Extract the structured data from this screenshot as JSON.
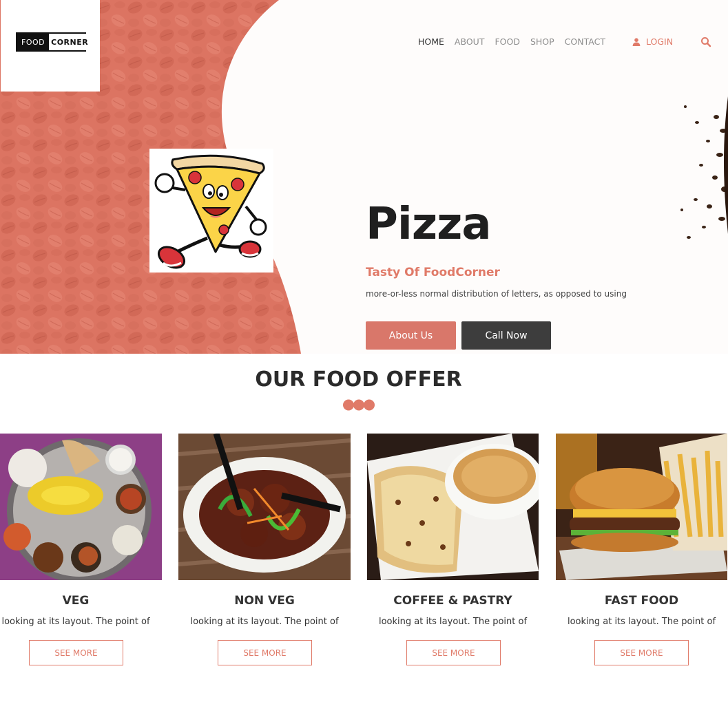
{
  "logo": {
    "part1": "FOOD",
    "part2": "CORNER"
  },
  "nav": {
    "items": [
      "HOME",
      "ABOUT",
      "FOOD",
      "SHOP",
      "CONTACT"
    ],
    "active": "HOME"
  },
  "header": {
    "login_label": "LOGIN",
    "login_icon": "user-icon",
    "search_icon": "search-icon"
  },
  "hero": {
    "title": "Pizza",
    "subtitle": "Tasty Of FoodCorner",
    "description": "more-or-less normal distribution of letters, as opposed to using",
    "about_button": "About Us",
    "call_button": "Call Now"
  },
  "offer": {
    "title": "OUR FOOD OFFER",
    "cards": [
      {
        "title": "VEG",
        "description": "looking at its layout. The point of",
        "button": "SEE MORE"
      },
      {
        "title": "NON VEG",
        "description": "looking at its layout. The point of",
        "button": "SEE MORE"
      },
      {
        "title": "COFFEE & PASTRY",
        "description": "looking at its layout. The point of",
        "button": "SEE MORE"
      },
      {
        "title": "FAST FOOD",
        "description": "looking at its layout. The point of",
        "button": "SEE MORE"
      }
    ]
  },
  "colors": {
    "accent": "#e07a68",
    "hero_left": "#dc7462",
    "dark_button": "#3d3d3d",
    "heading": "#2b2b2b"
  }
}
